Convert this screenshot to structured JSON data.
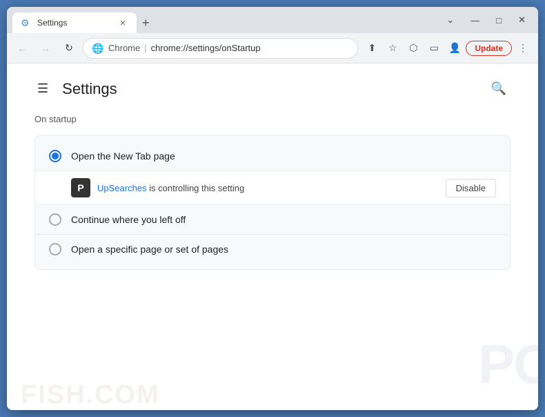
{
  "browser": {
    "tab_title": "Settings",
    "tab_icon": "⚙",
    "new_tab_label": "+",
    "close_label": "✕",
    "minimize_label": "—",
    "maximize_label": "□",
    "dropdown_label": "⌄"
  },
  "toolbar": {
    "back_label": "←",
    "forward_label": "→",
    "refresh_label": "↻",
    "chrome_label": "Chrome",
    "address_divider": "|",
    "address_path": "chrome://settings/onStartup",
    "share_icon": "⬆",
    "bookmark_icon": "☆",
    "extensions_icon": "⬡",
    "profile_icon": "👤",
    "sidebar_icon": "▭",
    "update_label": "Update",
    "menu_icon": "⋮"
  },
  "settings": {
    "hamburger_label": "☰",
    "title": "Settings",
    "search_icon": "🔍",
    "section_label": "On startup",
    "options": [
      {
        "label": "Open the New Tab page",
        "selected": true
      },
      {
        "label": "Continue where you left off",
        "selected": false
      },
      {
        "label": "Open a specific page or set of pages",
        "selected": false
      }
    ],
    "extension": {
      "icon_label": "P",
      "name": "UpSearches",
      "text": " is controlling this setting",
      "disable_label": "Disable"
    }
  }
}
